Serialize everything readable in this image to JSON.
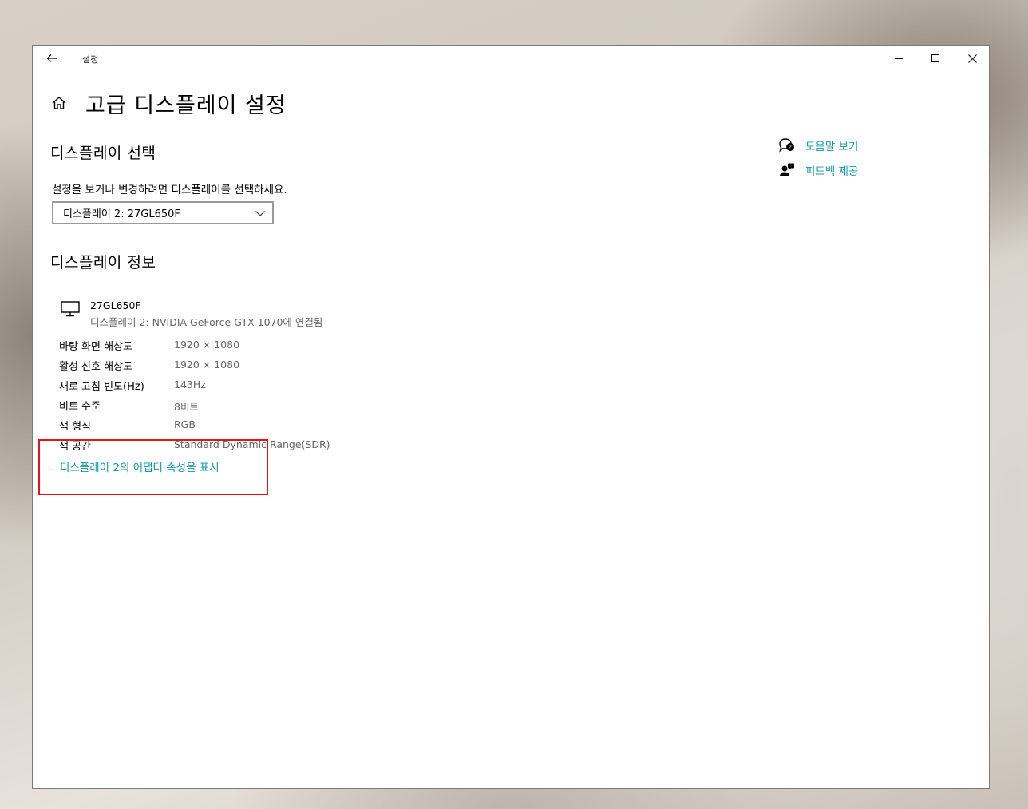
{
  "window": {
    "title": "설정"
  },
  "page": {
    "title": "고급 디스플레이 설정"
  },
  "display_select": {
    "section_title": "디스플레이 선택",
    "description": "설정을 보거나 변경하려면 디스플레이를 선택하세요.",
    "selected": "디스플레이 2: 27GL650F"
  },
  "display_info": {
    "section_title": "디스플레이 정보",
    "name": "27GL650F",
    "connection": "디스플레이 2: NVIDIA GeForce GTX 1070에 연결됨",
    "rows": [
      {
        "label": "바탕 화면 해상도",
        "value": "1920 × 1080"
      },
      {
        "label": "활성 신호 해상도",
        "value": "1920 × 1080"
      },
      {
        "label": "새로 고침 빈도(Hz)",
        "value": "143Hz"
      },
      {
        "label": "비트 수준",
        "value": "8비트"
      },
      {
        "label": "색 형식",
        "value": "RGB"
      },
      {
        "label": "색 공간",
        "value": "Standard Dynamic Range(SDR)"
      }
    ],
    "adapter_link": "디스플레이 2의 어댑터 속성을 표시"
  },
  "help": {
    "get_help": "도움말 보기",
    "feedback": "피드백 제공"
  },
  "colors": {
    "accent": "#0e9aa7",
    "highlight": "#e11111"
  }
}
